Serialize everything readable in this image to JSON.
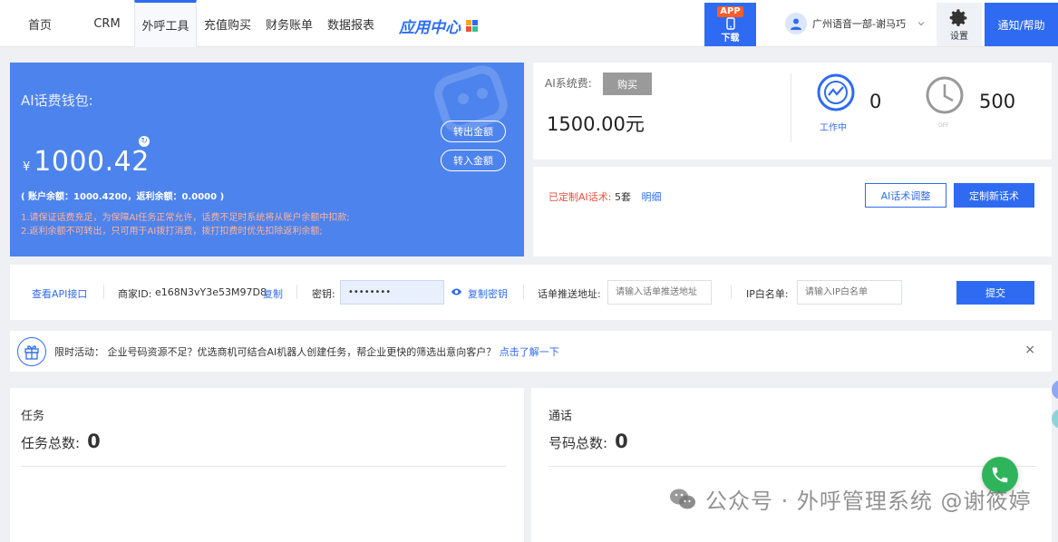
{
  "nav": {
    "items": [
      "首页",
      "CRM",
      "外呼工具",
      "充值购买",
      "财务账单",
      "数据报表"
    ],
    "active_index": 2,
    "app_center": "应用中心",
    "app_download": {
      "badge": "APP",
      "label": "下载"
    },
    "user": "广州语音一部-谢马巧",
    "settings": "设置",
    "notice": "通知/帮助"
  },
  "wallet": {
    "title": "AI话费钱包:",
    "currency": "¥",
    "amount": "1000.42",
    "transfer_out": "转出金额",
    "transfer_in": "转入金额",
    "balance_line": "( 账户余额：1000.4200，返利余额：0.0000 )",
    "tip1": "1.请保证话费充足，为保障AI任务正常允许，话费不足时系统将从账户余额中扣款;",
    "tip2": "2.返利余额不可转出，只可用于AI拨打消费，拨打扣费时优先扣除返利余额;"
  },
  "ai_fee": {
    "label": "AI系统费:",
    "buy": "购买",
    "value": "1500.00元",
    "working_count": "0",
    "working_label": "工作中",
    "off_count": "500",
    "off_label": "OFF"
  },
  "script": {
    "label": "已定制AI话术:",
    "count": "5套",
    "detail": "明细",
    "adjust": "AI话术调整",
    "create": "定制新话术"
  },
  "api": {
    "doc_link": "查看API接口",
    "merchant_label": "商家ID:",
    "merchant_id": "e168N3vY3e53M97D8",
    "copy": "复制",
    "secret_label": "密钥:",
    "secret_value": "••••••••",
    "copy_secret": "复制密钥",
    "push_label": "话单推送地址:",
    "push_placeholder": "请输入话单推送地址",
    "ip_label": "IP白名单:",
    "ip_placeholder": "请输入IP白名单",
    "submit": "提交"
  },
  "activity": {
    "prefix": "限时活动：",
    "text": "企业号码资源不足？优选商机可结合AI机器人创建任务，帮企业更快的筛选出意向客户？",
    "link": "点击了解一下",
    "close": "×"
  },
  "task_card": {
    "title": "任务",
    "label": "任务总数:",
    "value": "0"
  },
  "call_card": {
    "title": "通话",
    "label": "号码总数:",
    "value": "0"
  },
  "watermark": "公众号 · 外呼管理系统 @谢筱婷",
  "colors": {
    "primary": "#2f6bf2",
    "wallet_bg": "#4d83ec",
    "warning": "#e8513d"
  }
}
